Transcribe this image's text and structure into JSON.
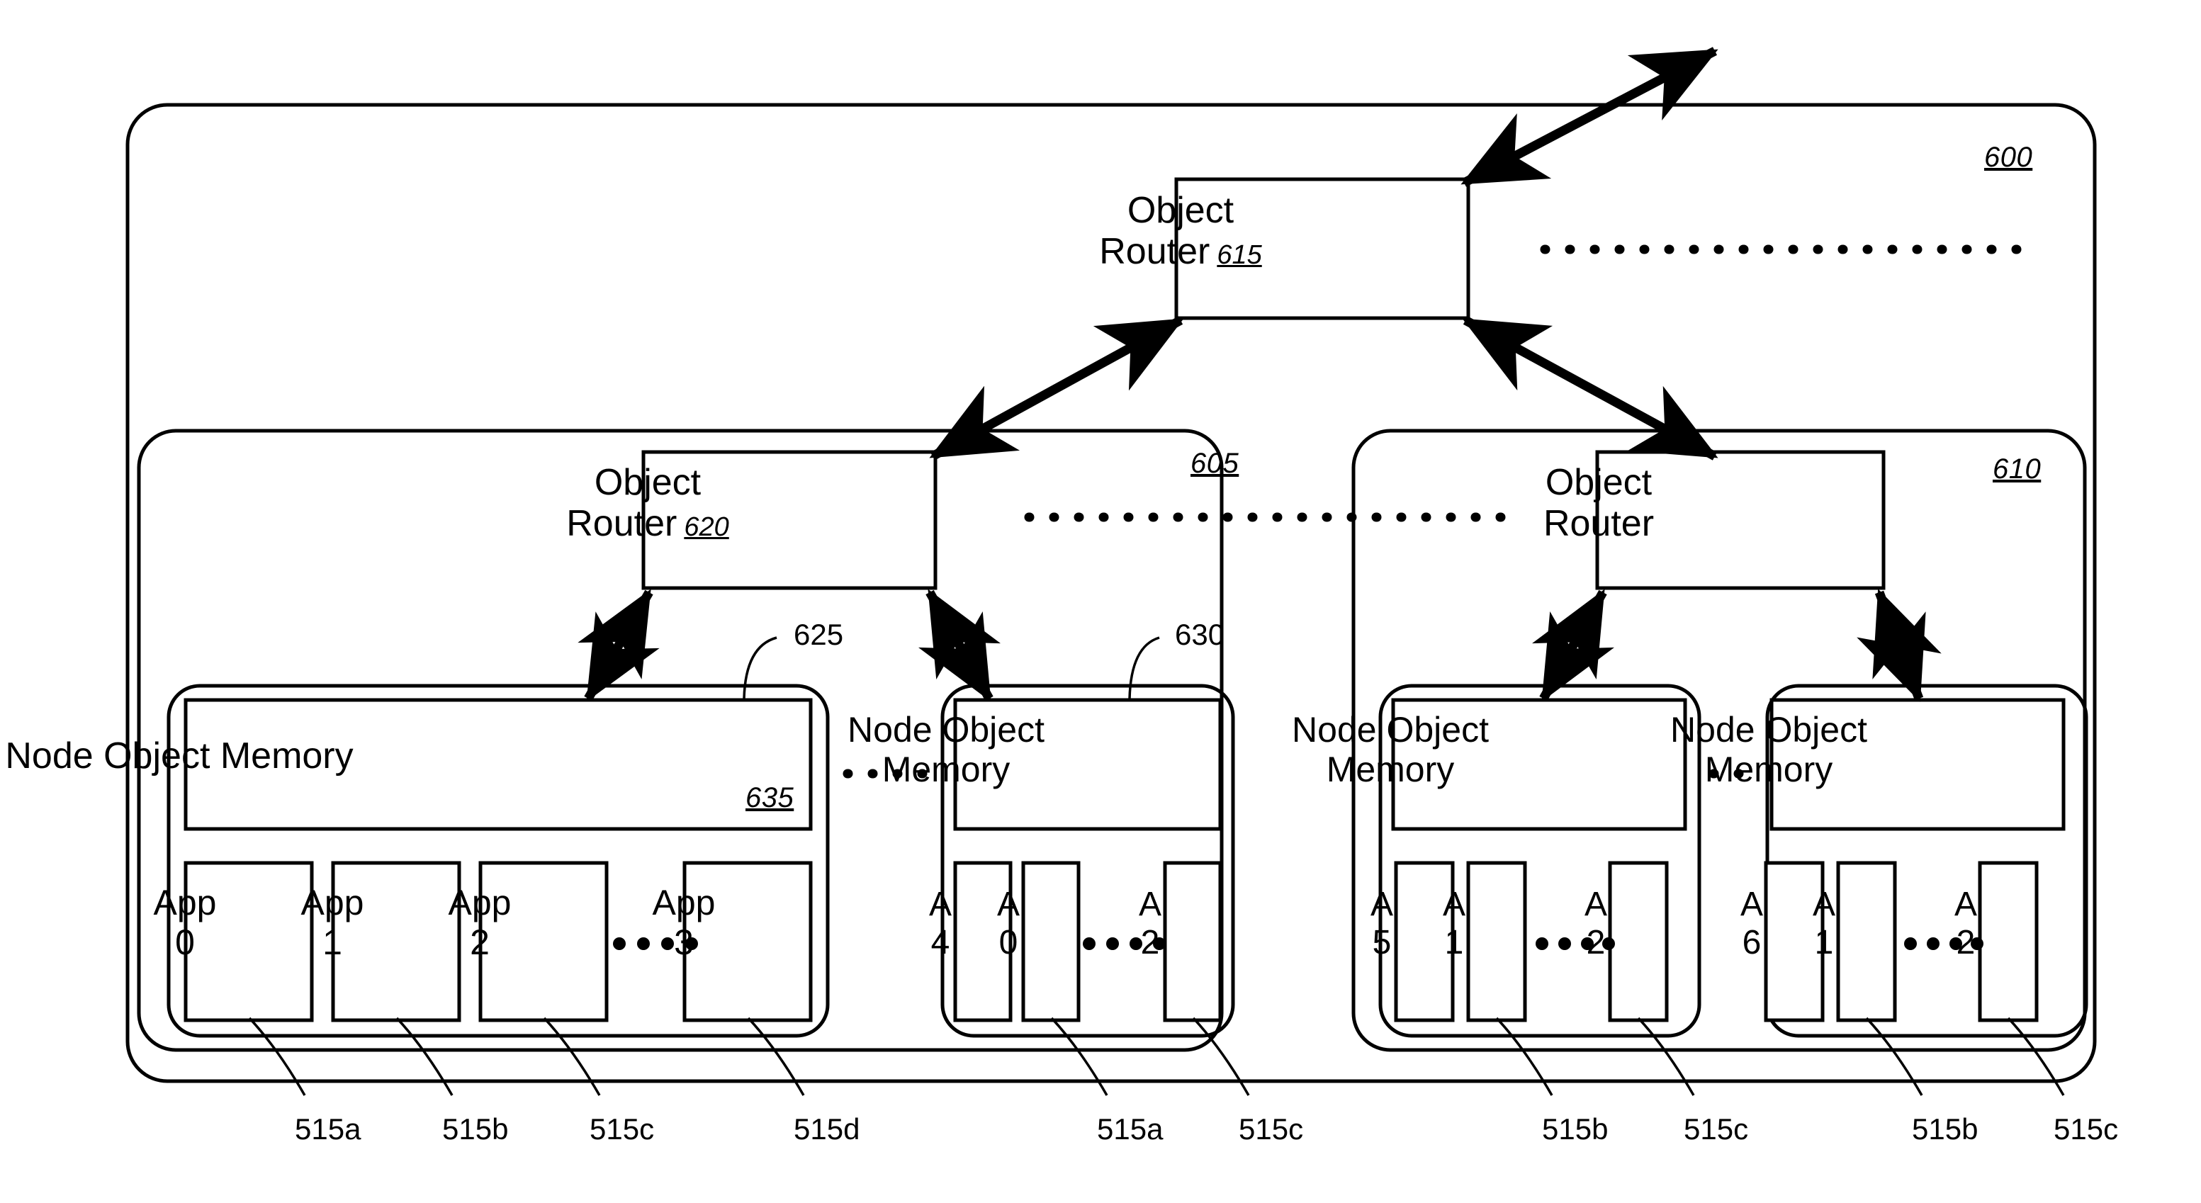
{
  "figure": {
    "outer_label": "600",
    "node_group_left_label": "605",
    "node_group_right_label": "610"
  },
  "routers": {
    "top": {
      "name": "router-615",
      "line1": "Object",
      "line2": "Router",
      "ref": "615"
    },
    "left": {
      "name": "router-620",
      "line1": "Object",
      "line2": "Router",
      "ref": "620"
    },
    "right": {
      "name": "router-right",
      "line1": "Object",
      "line2": "Router",
      "ref": ""
    }
  },
  "callouts": {
    "node_memory_group_625": "625",
    "node_memory_group_630": "630",
    "node_object_memory_635": "635"
  },
  "nodes": [
    {
      "id": "node-a",
      "memory_line1": "Node Object Memory",
      "memory_line2": "",
      "memory_ref": "635",
      "apps": [
        {
          "line1": "App",
          "line2": "0",
          "ref": "515a"
        },
        {
          "line1": "App",
          "line2": "1",
          "ref": "515b"
        },
        {
          "line1": "App",
          "line2": "2",
          "ref": "515c"
        },
        {
          "line1": "App",
          "line2": "3",
          "ref": "515d"
        }
      ],
      "ellipsis_before_last": true
    },
    {
      "id": "node-b",
      "memory_line1": "Node Object",
      "memory_line2": "Memory",
      "memory_ref": "",
      "apps": [
        {
          "line1": "A",
          "line2": "4",
          "ref": ""
        },
        {
          "line1": "A",
          "line2": "0",
          "ref": "515a"
        },
        {
          "line1": "A",
          "line2": "2",
          "ref": "515c"
        }
      ],
      "ellipsis_before_last": true
    },
    {
      "id": "node-c",
      "memory_line1": "Node Object",
      "memory_line2": "Memory",
      "memory_ref": "",
      "apps": [
        {
          "line1": "A",
          "line2": "5",
          "ref": ""
        },
        {
          "line1": "A",
          "line2": "1",
          "ref": "515b"
        },
        {
          "line1": "A",
          "line2": "2",
          "ref": "515c"
        }
      ],
      "ellipsis_before_last": true
    },
    {
      "id": "node-d",
      "memory_line1": "Node Object",
      "memory_line2": "Memory",
      "memory_ref": "",
      "apps": [
        {
          "line1": "A",
          "line2": "6",
          "ref": ""
        },
        {
          "line1": "A",
          "line2": "1",
          "ref": "515b"
        },
        {
          "line1": "A",
          "line2": "2",
          "ref": "515c"
        }
      ],
      "ellipsis_before_last": true
    }
  ],
  "bottom_refs": [
    "515a",
    "515b",
    "515c",
    "515d",
    "515a",
    "515c",
    "515b",
    "515c",
    "515b",
    "515c"
  ],
  "colors": {
    "stroke": "#000000",
    "background": "#ffffff"
  }
}
